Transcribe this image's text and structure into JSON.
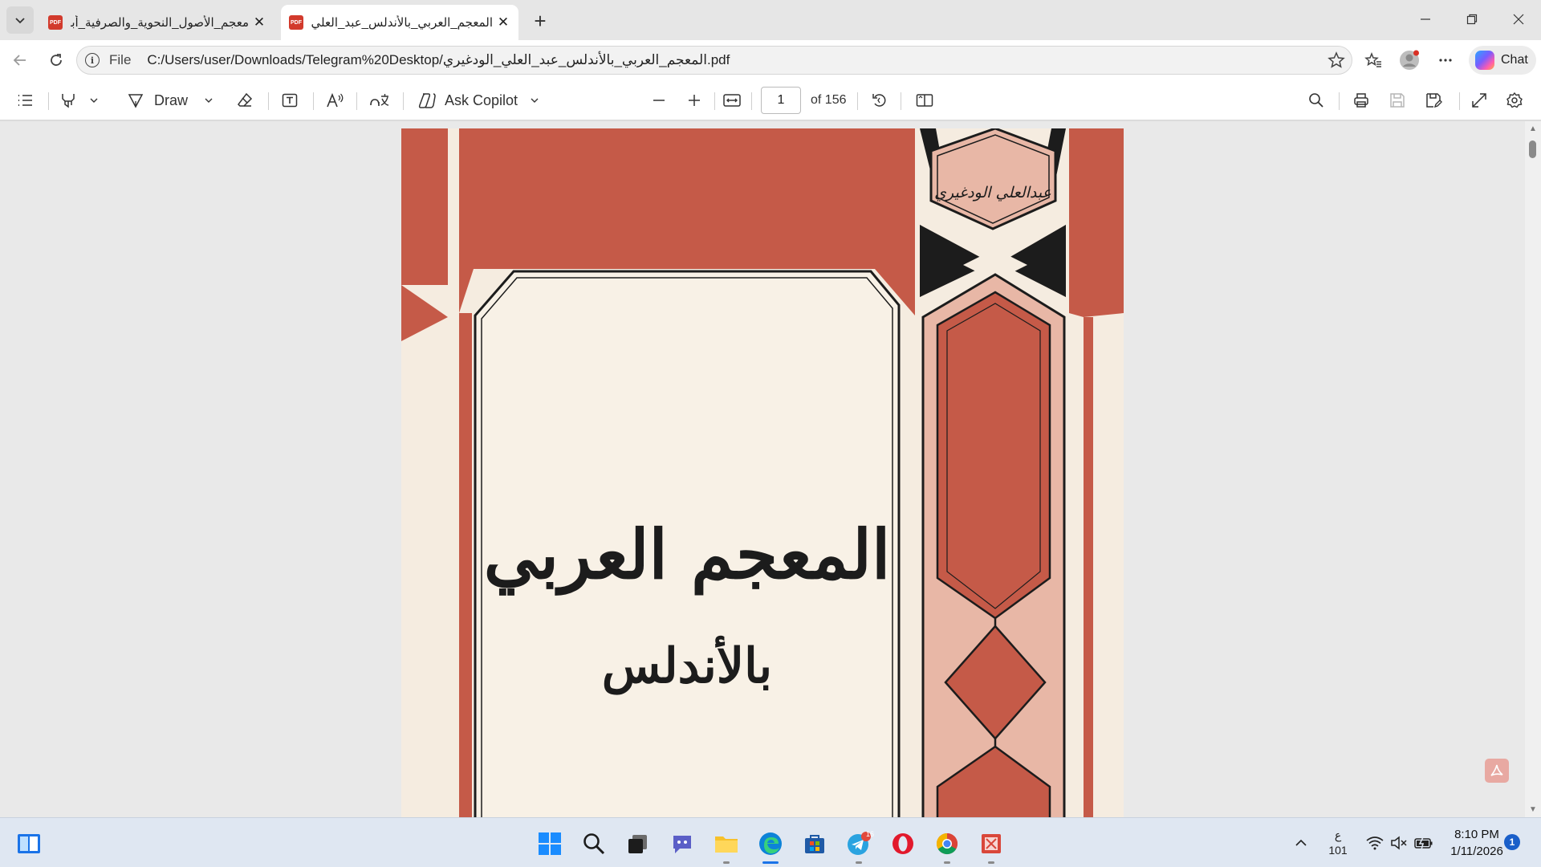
{
  "browser": {
    "tabs": [
      {
        "title": "معجم_الأصول_النحوية_والصرفية_أبو",
        "active": false,
        "icon_text": "PDF"
      },
      {
        "title": "المعجم_العربي_بالأندلس_عبد_العلي_",
        "active": true,
        "icon_text": "PDF"
      }
    ],
    "tab_close_glyph": "✕",
    "new_tab_glyph": "+"
  },
  "address_bar": {
    "scheme": "File",
    "url": "C:/Users/user/Downloads/Telegram%20Desktop/المعجم_العربي_بالأندلس_عبد_العلي_الودغيري.pdf",
    "chat_label": "Chat"
  },
  "pdf_toolbar": {
    "draw_label": "Draw",
    "ask_copilot_label": "Ask Copilot",
    "current_page": "1",
    "total_pages": "of 156"
  },
  "document": {
    "author": "عبدالعلي الودغيري",
    "title": "المعجم العربي",
    "subtitle": "بالأندلس",
    "colors": {
      "red": "#c55a48",
      "cream": "#f5ece0",
      "pink": "#e8b7a6",
      "black": "#1c1c1c"
    }
  },
  "taskbar": {
    "telegram_badge": "16",
    "lang_char": "ع",
    "lang_code": "101",
    "time": "8:10 PM",
    "date": "1/11/2026",
    "notifications": "1"
  }
}
